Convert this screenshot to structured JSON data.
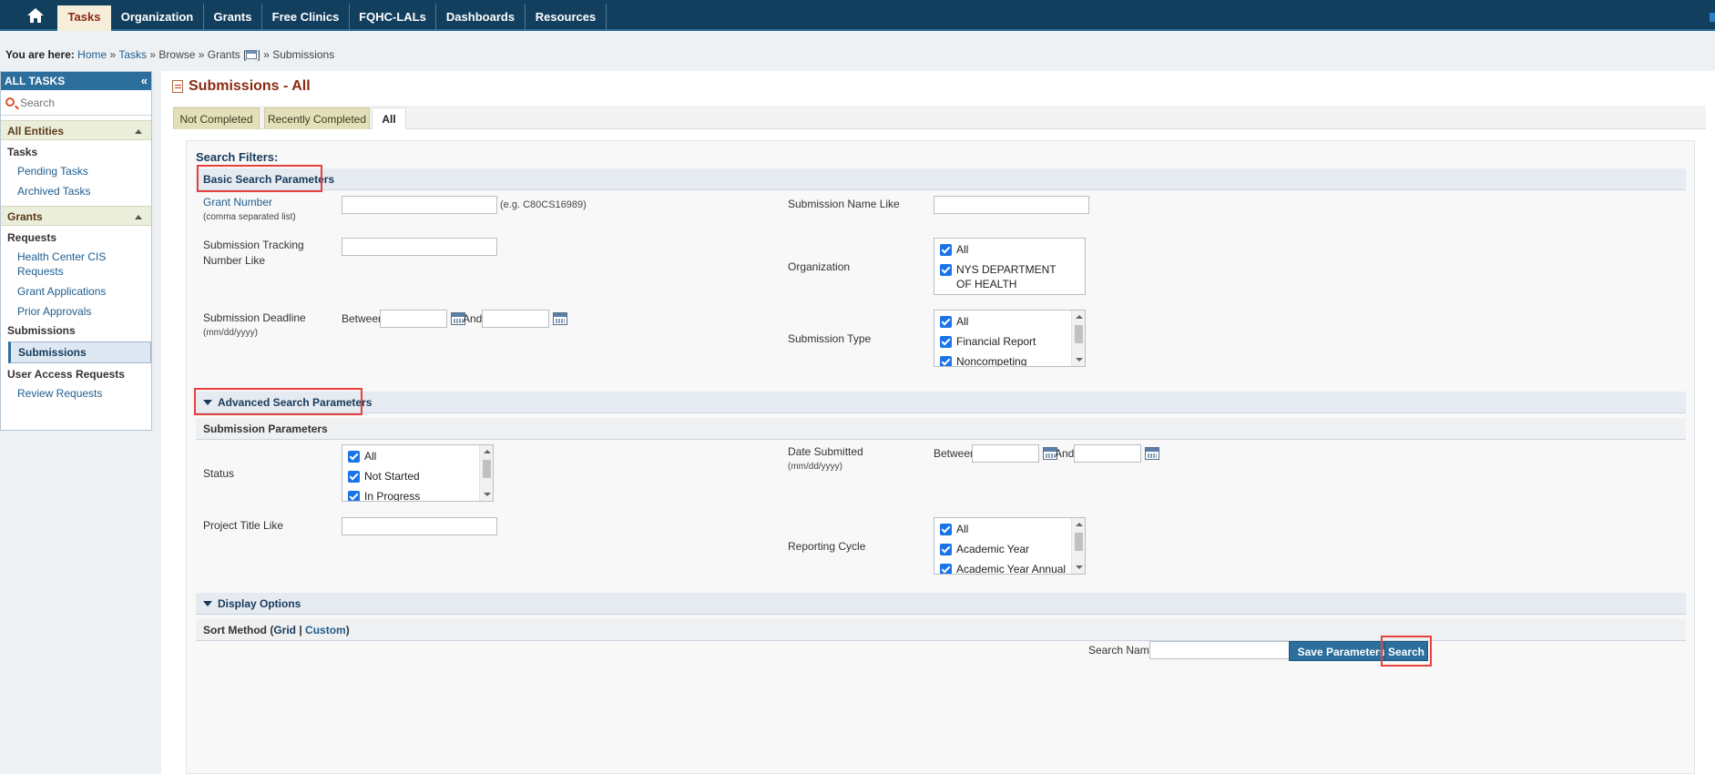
{
  "nav": {
    "tabs": [
      "Tasks",
      "Organization",
      "Grants",
      "Free Clinics",
      "FQHC-LALs",
      "Dashboards",
      "Resources"
    ],
    "active": "Tasks"
  },
  "breadcrumb": {
    "prefix": "You are here:",
    "home": "Home",
    "tasks": "Tasks",
    "browse": "Browse",
    "grants": "Grants [",
    "grants_close": "]",
    "current": "Submissions",
    "sep": "»"
  },
  "sidebar": {
    "title": "ALL TASKS",
    "collapse_glyph": "«",
    "search_placeholder": "Search",
    "sections": [
      {
        "label": "All Entities",
        "groups": [
          {
            "label": "Tasks",
            "items": [
              "Pending Tasks",
              "Archived Tasks"
            ]
          }
        ]
      },
      {
        "label": "Grants",
        "groups": [
          {
            "label": "Requests",
            "items": [
              "Health Center CIS Requests",
              "Grant Applications",
              "Prior Approvals"
            ]
          },
          {
            "label": "Submissions",
            "items": [
              "Submissions"
            ]
          },
          {
            "label": "User Access Requests",
            "items": [
              "Review Requests"
            ]
          }
        ]
      }
    ],
    "active_item": "Submissions"
  },
  "main": {
    "title": "Submissions - All",
    "tabs": [
      "Not Completed",
      "Recently Completed",
      "All"
    ],
    "active_tab": "All",
    "search_filters_label": "Search Filters:",
    "basic": {
      "header": "Basic Search Parameters",
      "grant_number_label": "Grant Number",
      "grant_number_hint": "(comma separated list)",
      "grant_number_example": "(e.g. C80CS16989)",
      "tracking_label": "Submission Tracking Number Like",
      "deadline_label": "Submission Deadline",
      "deadline_hint": "(mm/dd/yyyy)",
      "between": "Between",
      "and": "And",
      "name_like_label": "Submission Name Like",
      "organization_label": "Organization",
      "organization_options": [
        "All",
        "NYS DEPARTMENT OF HEALTH"
      ],
      "type_label": "Submission Type",
      "type_options": [
        "All",
        "Financial Report",
        "Noncompeting Continuations"
      ]
    },
    "advanced": {
      "header": "Advanced Search Parameters",
      "submission_params": "Submission Parameters",
      "status_label": "Status",
      "status_options": [
        "All",
        "Not Started",
        "In Progress"
      ],
      "project_title_label": "Project Title Like",
      "date_submitted_label": "Date Submitted",
      "date_submitted_hint": "(mm/dd/yyyy)",
      "between": "Between",
      "and": "And",
      "reporting_cycle_label": "Reporting Cycle",
      "reporting_cycle_options": [
        "All",
        "Academic Year",
        "Academic Year Annual"
      ]
    },
    "display": {
      "header": "Display Options",
      "sort_prefix": "Sort Method (",
      "sort_grid": "Grid",
      "sort_sep": " | ",
      "sort_custom": "Custom",
      "sort_suffix": ")"
    },
    "footer": {
      "search_name_label": "Search Name:",
      "save_button": "Save Parameters",
      "search_button": "Search"
    }
  },
  "colors": {
    "nav_bg": "#123f5e",
    "accent": "#2c6e9c",
    "title": "#8a2a12",
    "highlight": "#e8413c",
    "checkbox": "#1a73e8"
  }
}
